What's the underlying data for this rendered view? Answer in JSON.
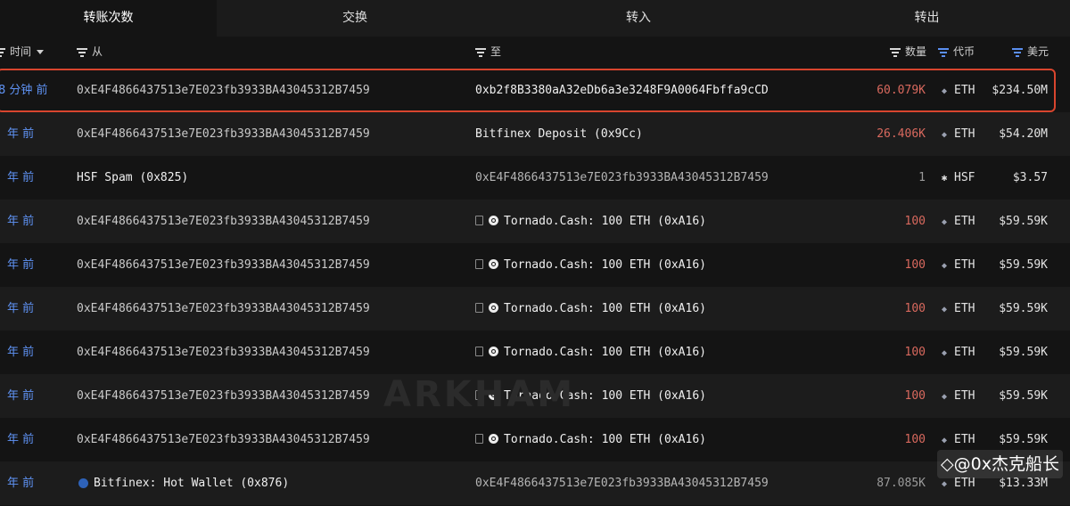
{
  "tabs": [
    "转账次数",
    "交换",
    "转入",
    "转出"
  ],
  "header": {
    "time": "时间",
    "from": "从",
    "to": "至",
    "quantity": "数量",
    "token": "代币",
    "usd": "美元"
  },
  "rows": [
    {
      "time": "8 分钟 前",
      "from": "0xE4F4866437513e7E023fb3933BA43045312B7459",
      "to": "0xb2f8B3380aA32eDb6a3e3248F9A0064Fbffa9cCD",
      "quantity": "60.079K",
      "token": "ETH",
      "usd": "$234.50M"
    },
    {
      "time": "年 前",
      "from": "0xE4F4866437513e7E023fb3933BA43045312B7459",
      "to": "Bitfinex Deposit (0x9Cc)",
      "quantity": "26.406K",
      "token": "ETH",
      "usd": "$54.20M"
    },
    {
      "time": "年 前",
      "from": "HSF Spam (0x825)",
      "to": "0xE4F4866437513e7E023fb3933BA43045312B7459",
      "quantity": "1",
      "token": "HSF",
      "usd": "$3.57"
    },
    {
      "time": "年 前",
      "from": "0xE4F4866437513e7E023fb3933BA43045312B7459",
      "to": "Tornado.Cash: 100 ETH (0xA16)",
      "quantity": "100",
      "token": "ETH",
      "usd": "$59.59K"
    },
    {
      "time": "年 前",
      "from": "0xE4F4866437513e7E023fb3933BA43045312B7459",
      "to": "Tornado.Cash: 100 ETH (0xA16)",
      "quantity": "100",
      "token": "ETH",
      "usd": "$59.59K"
    },
    {
      "time": "年 前",
      "from": "0xE4F4866437513e7E023fb3933BA43045312B7459",
      "to": "Tornado.Cash: 100 ETH (0xA16)",
      "quantity": "100",
      "token": "ETH",
      "usd": "$59.59K"
    },
    {
      "time": "年 前",
      "from": "0xE4F4866437513e7E023fb3933BA43045312B7459",
      "to": "Tornado.Cash: 100 ETH (0xA16)",
      "quantity": "100",
      "token": "ETH",
      "usd": "$59.59K"
    },
    {
      "time": "年 前",
      "from": "0xE4F4866437513e7E023fb3933BA43045312B7459",
      "to": "Tornado.Cash: 100 ETH (0xA16)",
      "quantity": "100",
      "token": "ETH",
      "usd": "$59.59K"
    },
    {
      "time": "年 前",
      "from": "0xE4F4866437513e7E023fb3933BA43045312B7459",
      "to": "Tornado.Cash: 100 ETH (0xA16)",
      "quantity": "100",
      "token": "ETH",
      "usd": "$59.59K"
    },
    {
      "time": "年 前",
      "from": "Bitfinex: Hot Wallet (0x876)",
      "to": "0xE4F4866437513e7E023fb3933BA43045312B7459",
      "quantity": "87.085K",
      "token": "ETH",
      "usd": "$13.33M"
    }
  ],
  "colors": {
    "quantity_out": "#d9695e",
    "quantity_in": "#9a9a9a",
    "time_link": "#5f93f5",
    "highlight_border": "#d8452e"
  },
  "watermark": "ARKHAM",
  "credit": "◇@0x杰克船长"
}
